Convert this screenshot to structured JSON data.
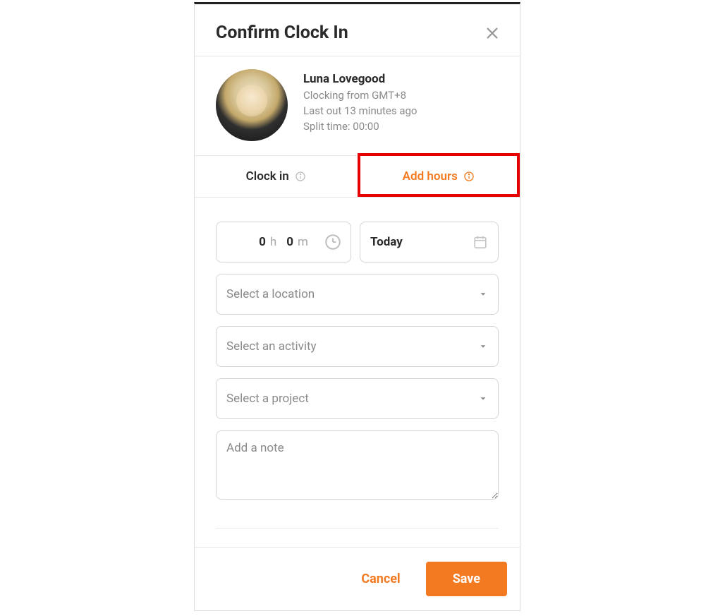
{
  "modal": {
    "title": "Confirm Clock In"
  },
  "user": {
    "name": "Luna Lovegood",
    "clocking_from": "Clocking from GMT+8",
    "last_out": "Last out 13 minutes ago",
    "split_time": "Split time: 00:00"
  },
  "tabs": {
    "clock_in": "Clock in",
    "add_hours": "Add hours",
    "active_index": 1
  },
  "duration": {
    "hours_value": "0",
    "hours_unit": "h",
    "minutes_value": "0",
    "minutes_unit": "m"
  },
  "date": {
    "label": "Today"
  },
  "selects": {
    "location_placeholder": "Select a location",
    "activity_placeholder": "Select an activity",
    "project_placeholder": "Select a project"
  },
  "note": {
    "placeholder": "Add a note"
  },
  "footer": {
    "cancel": "Cancel",
    "save": "Save"
  },
  "colors": {
    "accent": "#f37a20",
    "highlight": "#e60000"
  }
}
